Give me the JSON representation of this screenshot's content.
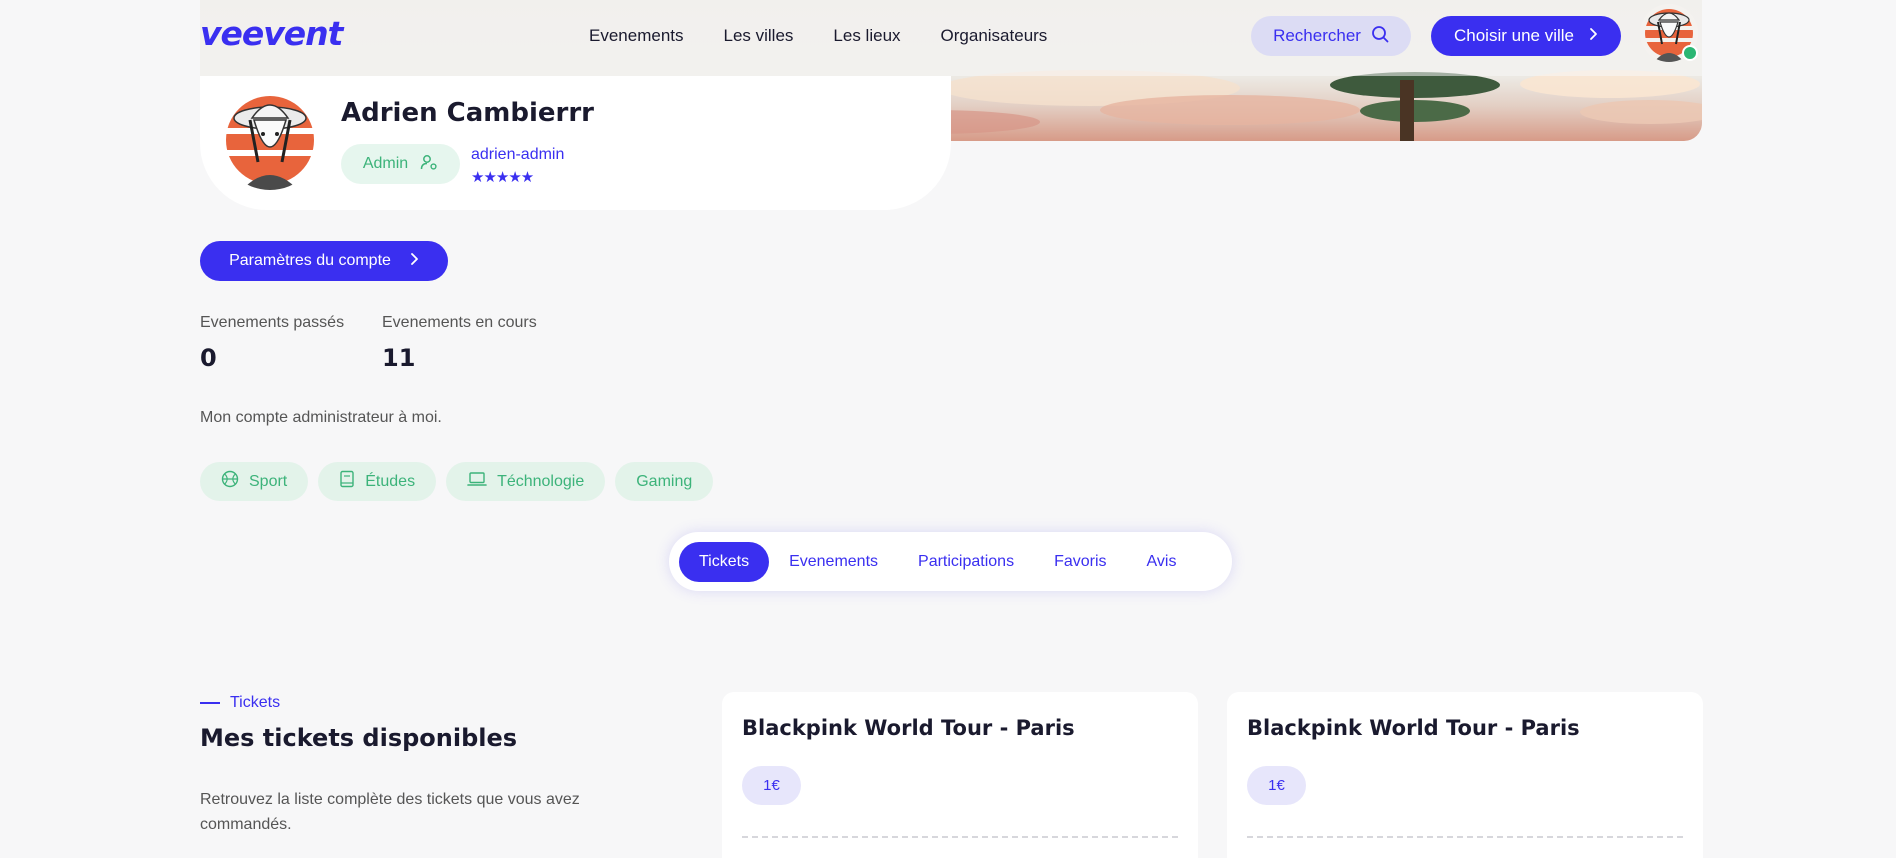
{
  "brand": {
    "logo": "veevent",
    "accent": "#3a2ff0",
    "success": "#3cb37a"
  },
  "nav": {
    "items": [
      "Evenements",
      "Les villes",
      "Les lieux",
      "Organisateurs"
    ]
  },
  "header": {
    "search_label": "Rechercher",
    "city_button_label": "Choisir une ville"
  },
  "profile": {
    "name": "Adrien Cambierrr",
    "role": "Admin",
    "username": "adrien-admin",
    "rating": "★★★★★",
    "settings_button": "Paramètres du compte",
    "stats": [
      {
        "label": "Evenements passés",
        "value": "0"
      },
      {
        "label": "Evenements en cours",
        "value": "11"
      }
    ],
    "bio": "Mon compte administrateur à moi.",
    "tags": [
      {
        "label": "Sport",
        "icon": "basketball-icon"
      },
      {
        "label": "Études",
        "icon": "book-icon"
      },
      {
        "label": "Téchnologie",
        "icon": "laptop-icon"
      },
      {
        "label": "Gaming",
        "icon": ""
      }
    ]
  },
  "tabs": {
    "items": [
      "Tickets",
      "Evenements",
      "Participations",
      "Favoris",
      "Avis"
    ],
    "active": "Tickets"
  },
  "section": {
    "kicker": "Tickets",
    "title": "Mes tickets disponibles",
    "description": "Retrouvez la liste complète des tickets que vous avez commandés."
  },
  "tickets": [
    {
      "title": "Blackpink World Tour - Paris",
      "price": "1€"
    },
    {
      "title": "Blackpink World Tour - Paris",
      "price": "1€"
    }
  ]
}
